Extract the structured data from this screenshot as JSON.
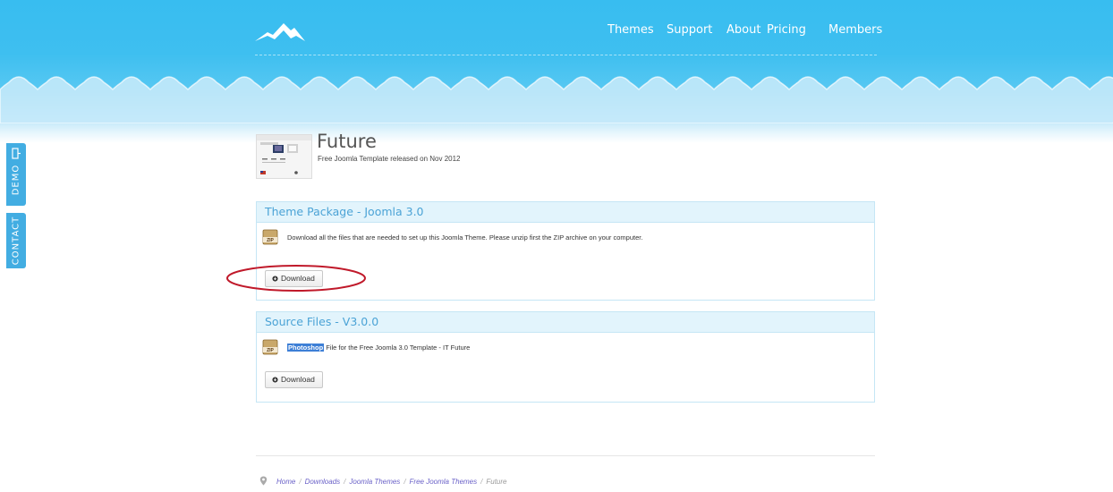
{
  "header": {
    "nav": [
      {
        "label": "Themes"
      },
      {
        "label": "Support"
      },
      {
        "label": "About"
      },
      {
        "label": "Pricing"
      },
      {
        "label": "Members"
      }
    ],
    "logo_icon": "mountain-logo-icon"
  },
  "side_tabs": {
    "demo_label": "DEMO",
    "contact_label": "CONTACT",
    "demo_icon": "door-exit-icon",
    "color": "#42ade2"
  },
  "template": {
    "title": "Future",
    "subtitle": "Free Joomla Template released on Nov 2012"
  },
  "panels": [
    {
      "heading": "Theme Package - Joomla 3.0",
      "description": "Download all the files that are needed to set up this Joomla Theme. Please unzip first the ZIP archive on your computer.",
      "button_label": "Download",
      "icon": "zip-icon"
    },
    {
      "heading": "Source Files - V3.0.0",
      "description_highlight": "Photoshop",
      "description_rest": " File for the Free Joomla 3.0 Template - IT Future",
      "button_label": "Download",
      "icon": "zip-icon"
    }
  ],
  "breadcrumb": {
    "items": [
      "Home",
      "Downloads",
      "Joomla Themes",
      "Free Joomla Themes"
    ],
    "current": "Future",
    "separator": "/",
    "icon": "location-pin-icon"
  },
  "colors": {
    "header_blue": "#38bdf0",
    "panel_heading": "#4ba3d6",
    "annotation_red": "#c0192a",
    "highlight": "#3d7fd6"
  }
}
